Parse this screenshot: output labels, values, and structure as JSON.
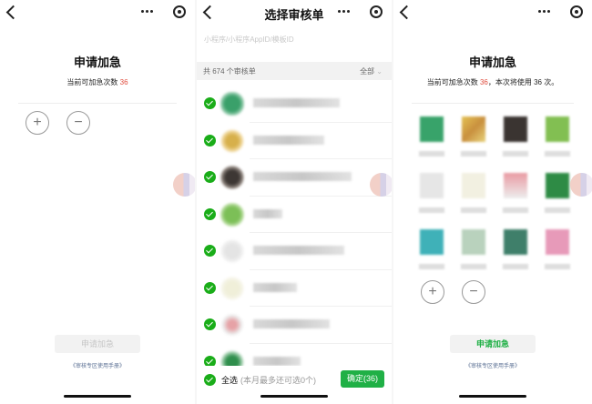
{
  "panel_apply_empty": {
    "title": "申请加急",
    "quota_prefix": "当前可加急次数",
    "quota_count": "36",
    "add_symbol": "+",
    "remove_symbol": "−",
    "apply_label": "申请加急",
    "manual_label": "《审核专区使用手册》"
  },
  "panel_select": {
    "nav_title": "选择审核单",
    "search_placeholder": "小程序/小程序AppID/模板ID",
    "count_label": "共 674 个审核单",
    "filter_label": "全部",
    "select_all_label": "全选",
    "select_all_hint": "(本月最多还可选0个)",
    "confirm_label": "确定(36)"
  },
  "panel_apply_filled": {
    "title": "申请加急",
    "quota_prefix": "当前可加急次数",
    "quota_count": "36",
    "quota_suffix": "，本次将使用 36 次。",
    "add_symbol": "+",
    "remove_symbol": "−",
    "apply_label": "申请加急",
    "manual_label": "《审核专区使用手册》"
  },
  "colors": {
    "accent_green": "#20b046",
    "check_green": "#1aad19",
    "quota_red": "#e04b3c",
    "link_blue": "#5a6f93"
  }
}
